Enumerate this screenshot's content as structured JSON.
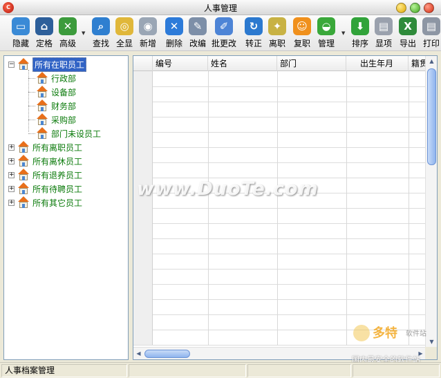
{
  "window": {
    "title": "人事管理"
  },
  "toolbar": {
    "buttons": [
      {
        "label": "隐藏",
        "icon": "monitor-icon",
        "color": "#3a8ad6"
      },
      {
        "label": "定格",
        "icon": "home-icon",
        "color": "#2d5f9a"
      },
      {
        "label": "高级",
        "icon": "tools-icon",
        "color": "#3c9b3c"
      },
      {
        "label": "查找",
        "icon": "search-icon",
        "color": "#2f7fd0"
      },
      {
        "label": "全显",
        "icon": "cd-icon",
        "color": "#e0b73a"
      },
      {
        "label": "新增",
        "icon": "camera-icon",
        "color": "#9aa6b5"
      },
      {
        "label": "删除",
        "icon": "delete-icon",
        "color": "#2d7bd9"
      },
      {
        "label": "改编",
        "icon": "edit-icon",
        "color": "#7d8fa8"
      },
      {
        "label": "批更改",
        "icon": "pen-icon",
        "color": "#4d84d6"
      },
      {
        "label": "转正",
        "icon": "refresh-icon",
        "color": "#2c79cf"
      },
      {
        "label": "离职",
        "icon": "badge-icon",
        "color": "#c8b244"
      },
      {
        "label": "复职",
        "icon": "smile-icon",
        "color": "#f0901c"
      },
      {
        "label": "管理",
        "icon": "globe-icon",
        "color": "#3aa83a"
      },
      {
        "label": "排序",
        "icon": "arrow-down-icon",
        "color": "#31a33a"
      },
      {
        "label": "显项",
        "icon": "printer-icon",
        "color": "#9aa1ad"
      },
      {
        "label": "导出",
        "icon": "excel-icon",
        "color": "#2f8b3b"
      },
      {
        "label": "打印",
        "icon": "print-icon",
        "color": "#8d96a4"
      }
    ]
  },
  "tree": {
    "root": "所有在职员工",
    "children": [
      "行政部",
      "设备部",
      "财务部",
      "采购部",
      "部门未设员工"
    ],
    "others": [
      "所有离职员工",
      "所有离休员工",
      "所有退养员工",
      "所有待聘员工",
      "所有其它员工"
    ]
  },
  "grid": {
    "columns": [
      "编号",
      "姓名",
      "部门",
      "出生年月",
      "籍贯"
    ]
  },
  "watermark": {
    "text": "www.DuoTe.com",
    "logo_main": "多特",
    "logo_side": "软件站",
    "logo_sub": "国内最安全的软件站"
  },
  "status": {
    "left": "人事档案管理"
  }
}
